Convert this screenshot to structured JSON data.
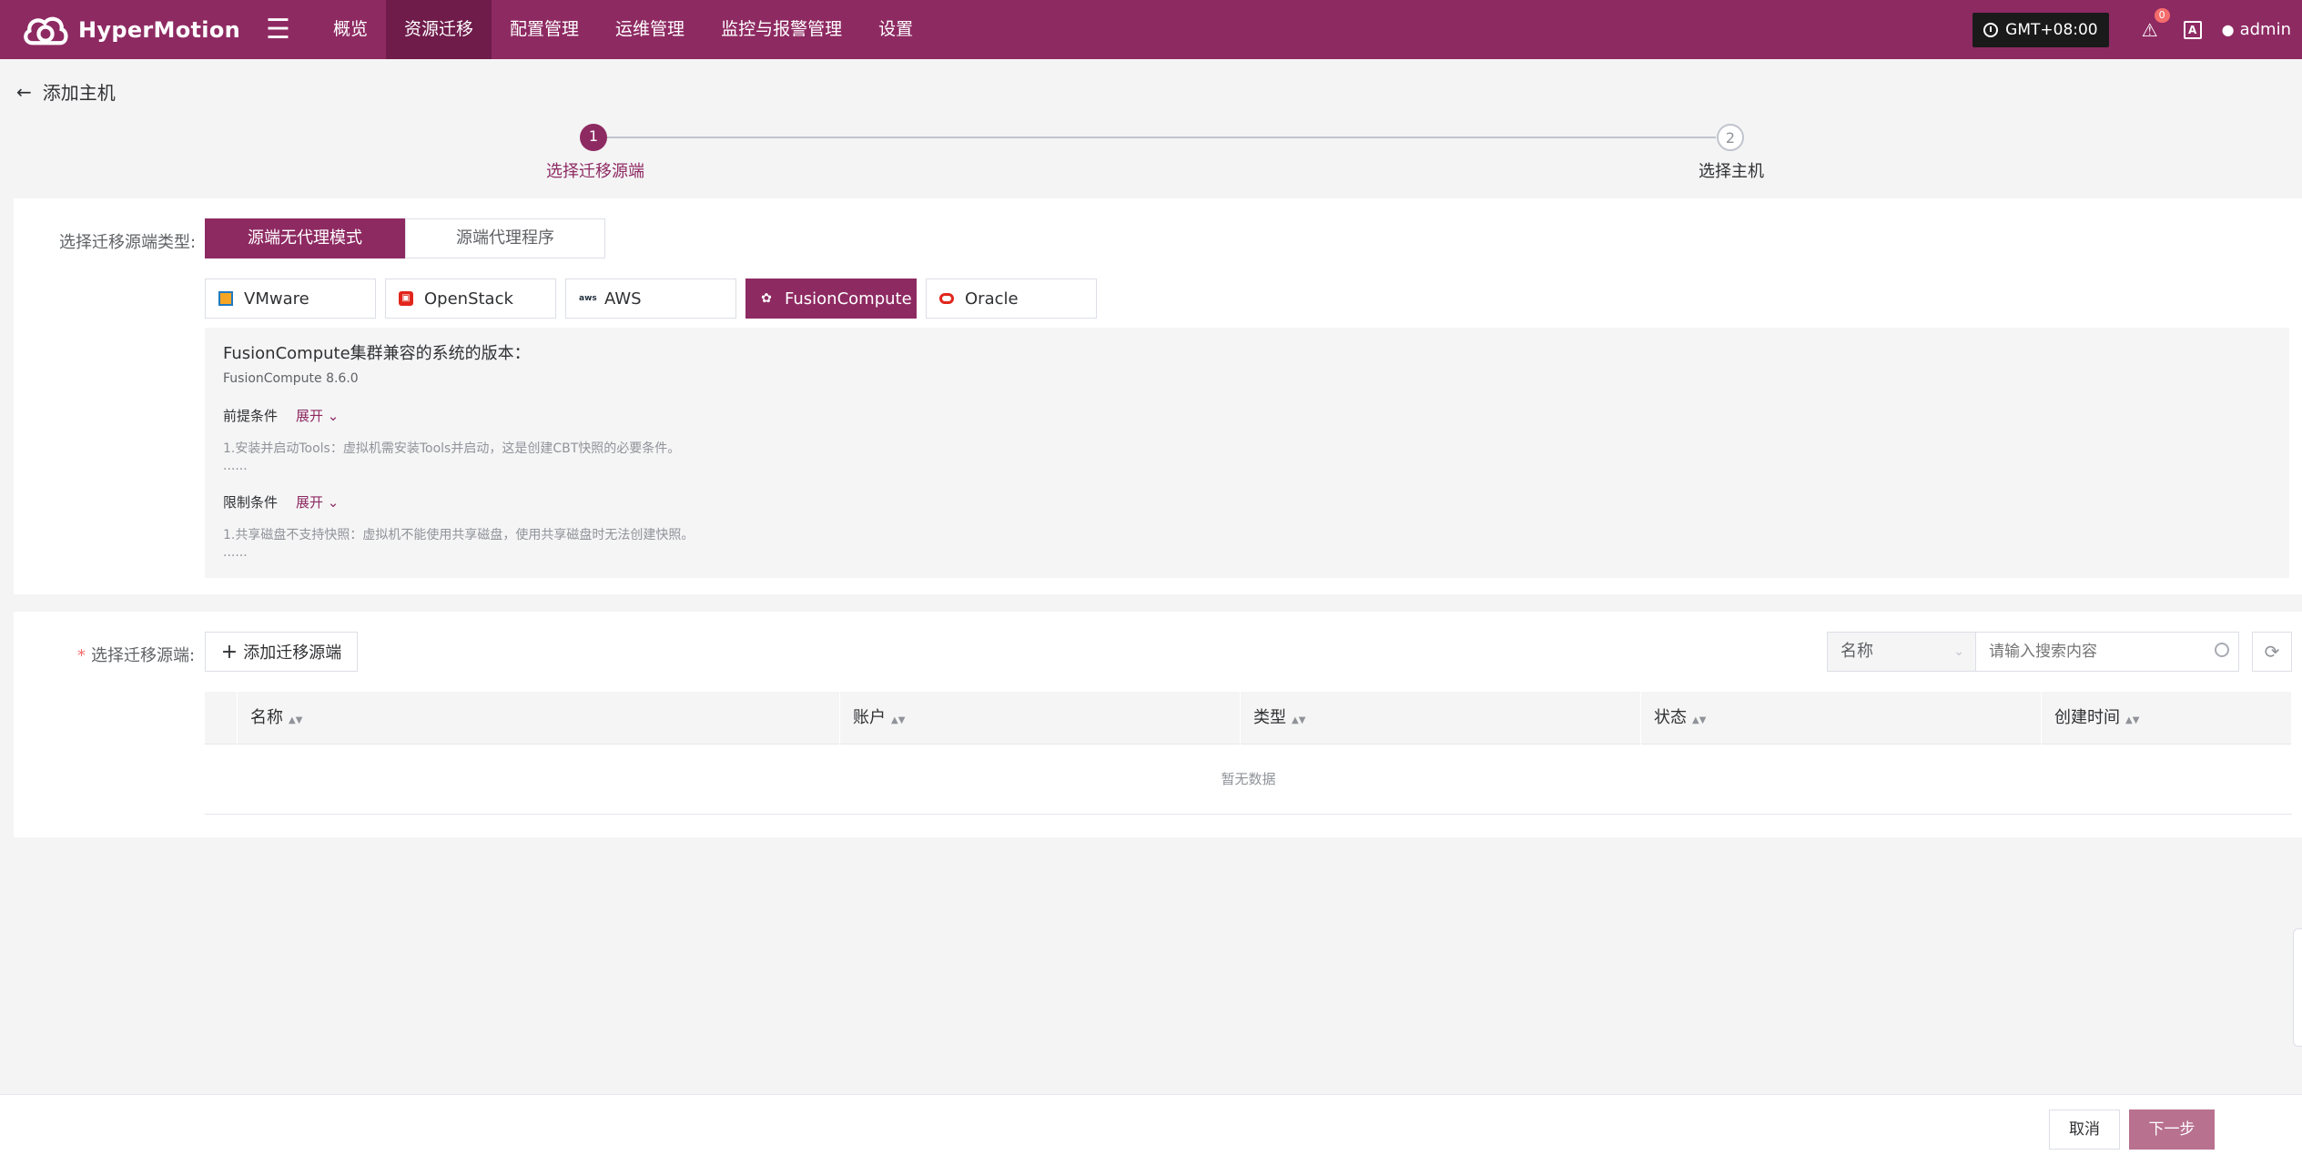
{
  "app": {
    "name": "HyperMotion"
  },
  "nav": {
    "items": [
      {
        "label": "概览"
      },
      {
        "label": "资源迁移"
      },
      {
        "label": "配置管理"
      },
      {
        "label": "运维管理"
      },
      {
        "label": "监控与报警管理"
      },
      {
        "label": "设置"
      }
    ],
    "active": "资源迁移"
  },
  "topbar": {
    "timezone": "GMT+08:00",
    "alert_count": "0",
    "lang_icon": "A",
    "user": "admin"
  },
  "page": {
    "title": "添加主机"
  },
  "steps": [
    {
      "num": "1",
      "label": "选择迁移源端",
      "state": "active"
    },
    {
      "num": "2",
      "label": "选择主机",
      "state": "pending"
    }
  ],
  "source_type": {
    "label": "选择迁移源端类型:",
    "modes": [
      {
        "label": "源端无代理模式",
        "selected": true
      },
      {
        "label": "源端代理程序",
        "selected": false
      }
    ],
    "platforms": [
      {
        "label": "VMware",
        "icon": "vmware-icon"
      },
      {
        "label": "OpenStack",
        "icon": "openstack-icon"
      },
      {
        "label": "AWS",
        "icon": "aws-icon"
      },
      {
        "label": "FusionCompute",
        "icon": "huawei-icon",
        "selected": true
      },
      {
        "label": "Oracle",
        "icon": "oracle-icon"
      }
    ],
    "platform_icons": {
      "aws": "aws"
    },
    "info": {
      "title": "FusionCompute集群兼容的系统的版本：",
      "version": "FusionCompute 8.6.0",
      "prereq_label": "前提条件",
      "prereq_expand": "展开",
      "prereq_text": "1.安装并启动Tools：虚拟机需安装Tools并启动，这是创建CBT快照的必要条件。",
      "prereq_more": "......",
      "limit_label": "限制条件",
      "limit_expand": "展开",
      "limit_text": "1.共享磁盘不支持快照：虚拟机不能使用共享磁盘，使用共享磁盘时无法创建快照。",
      "limit_more": "......"
    }
  },
  "source_select": {
    "required_mark": "*",
    "label": "选择迁移源端:",
    "add_button": "添加迁移源端",
    "search_field": "名称",
    "search_placeholder": "请输入搜索内容",
    "columns": [
      "名称",
      "账户",
      "类型",
      "状态",
      "创建时间"
    ],
    "empty_text": "暂无数据"
  },
  "footer": {
    "cancel": "取消",
    "next": "下一步"
  },
  "colors": {
    "brand": "#8e2a62",
    "brand_dark": "#6f1c4b",
    "next_disabled": "#b8718f"
  }
}
